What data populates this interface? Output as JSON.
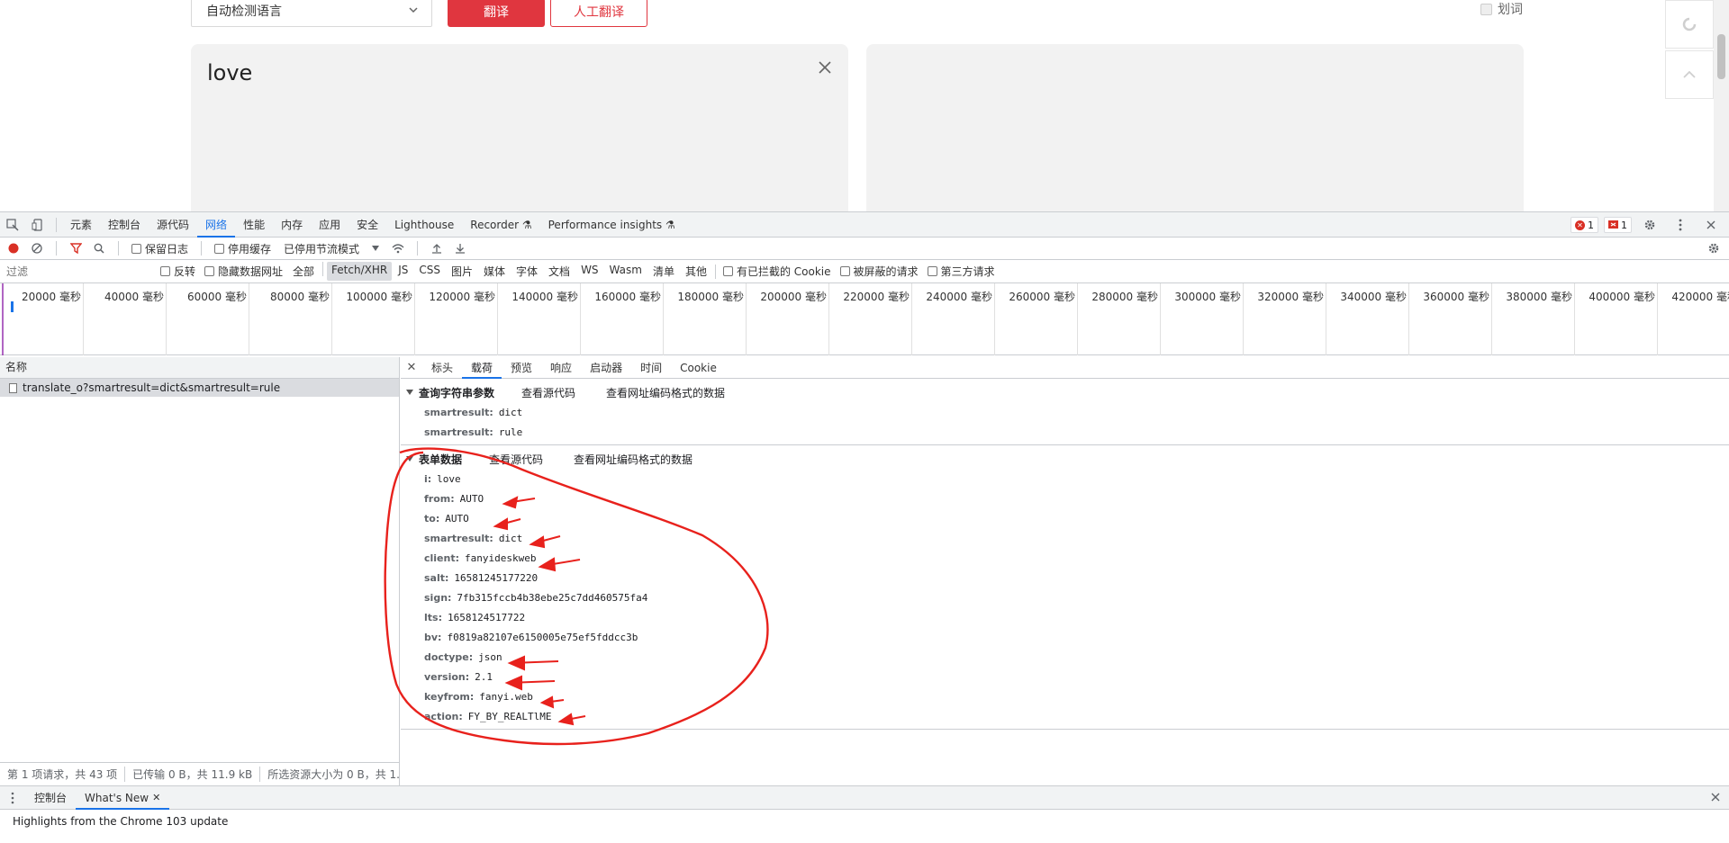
{
  "site": {
    "lang_select": "自动检测语言",
    "translate_button": "翻译",
    "human_translate_button": "人工翻译",
    "huaci_label": "划词",
    "input_text": "love"
  },
  "devtools": {
    "tabs": [
      "元素",
      "控制台",
      "源代码",
      "网络",
      "性能",
      "内存",
      "应用",
      "安全",
      "Lighthouse",
      "Recorder ⚗",
      "Performance insights ⚗"
    ],
    "active_tab": "网络",
    "error_count": "1",
    "issue_count": "1",
    "toolbar": {
      "preserve_log": "保留日志",
      "disable_cache": "停用缓存",
      "throttle": "已停用节流模式"
    },
    "filter": {
      "placeholder": "过滤",
      "invert": "反转",
      "hide_data_urls": "隐藏数据网址",
      "types": [
        "全部",
        "Fetch/XHR",
        "JS",
        "CSS",
        "图片",
        "媒体",
        "字体",
        "文档",
        "WS",
        "Wasm",
        "清单",
        "其他"
      ],
      "selected_type": "Fetch/XHR",
      "blocked_cookies": "有已拦截的 Cookie",
      "blocked_requests": "被屏蔽的请求",
      "third_party": "第三方请求"
    },
    "overview_ticks": [
      "20000 毫秒",
      "40000 毫秒",
      "60000 毫秒",
      "80000 毫秒",
      "100000 毫秒",
      "120000 毫秒",
      "140000 毫秒",
      "160000 毫秒",
      "180000 毫秒",
      "200000 毫秒",
      "220000 毫秒",
      "240000 毫秒",
      "260000 毫秒",
      "280000 毫秒",
      "300000 毫秒",
      "320000 毫秒",
      "340000 毫秒",
      "360000 毫秒",
      "380000 毫秒",
      "400000 毫秒",
      "420000 毫秒"
    ],
    "requests": {
      "header": "名称",
      "rows": [
        "translate_o?smartresult=dict&smartresult=rule"
      ],
      "status": [
        "第 1 项请求，共 43 项",
        "已传输 0 B，共 11.9 kB",
        "所选资源大小为 0 B，共 1.1 M"
      ]
    },
    "detail": {
      "tabs": [
        "标头",
        "载荷",
        "预览",
        "响应",
        "启动器",
        "时间",
        "Cookie"
      ],
      "active_tab": "载荷",
      "query": {
        "title": "查询字符串参数",
        "view_source": "查看源代码",
        "view_encoded": "查看网址编码格式的数据",
        "params": [
          {
            "k": "smartresult:",
            "v": "dict"
          },
          {
            "k": "smartresult:",
            "v": "rule"
          }
        ]
      },
      "form": {
        "title": "表单数据",
        "view_source": "查看源代码",
        "view_encoded": "查看网址编码格式的数据",
        "params": [
          {
            "k": "i:",
            "v": "love"
          },
          {
            "k": "from:",
            "v": "AUTO"
          },
          {
            "k": "to:",
            "v": "AUTO"
          },
          {
            "k": "smartresult:",
            "v": "dict"
          },
          {
            "k": "client:",
            "v": "fanyideskweb"
          },
          {
            "k": "salt:",
            "v": "16581245177220"
          },
          {
            "k": "sign:",
            "v": "7fb315fccb4b38ebe25c7dd460575fa4"
          },
          {
            "k": "lts:",
            "v": "1658124517722"
          },
          {
            "k": "bv:",
            "v": "f0819a82107e6150005e75ef5fddcc3b"
          },
          {
            "k": "doctype:",
            "v": "json"
          },
          {
            "k": "version:",
            "v": "2.1"
          },
          {
            "k": "keyfrom:",
            "v": "fanyi.web"
          },
          {
            "k": "action:",
            "v": "FY_BY_REALTlME"
          }
        ]
      }
    },
    "drawer": {
      "tabs": [
        "控制台",
        "What's New"
      ],
      "active_tab": "What's New",
      "content": "Highlights from the Chrome 103 update"
    }
  },
  "colors": {
    "brand_red": "#e0363f",
    "devtools_blue": "#1a73e8",
    "annotation_red": "#e8211c"
  }
}
